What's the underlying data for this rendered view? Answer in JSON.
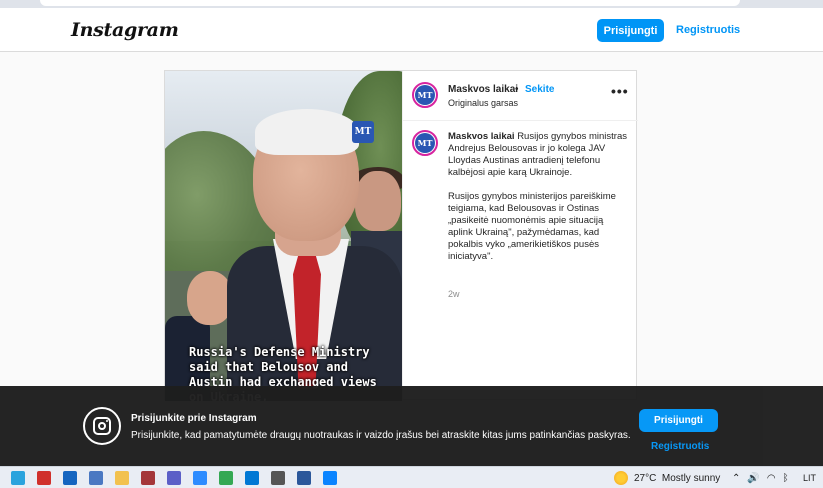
{
  "header": {
    "logo": "Instagram",
    "login_label": "Prisijungti",
    "register_label": "Registruotis"
  },
  "post": {
    "account": "Maskvos laikai",
    "separator": "•",
    "follow_label": "Sekite",
    "audio": "Originalus garsas",
    "more_label": "•••",
    "avatar_text": "MT",
    "watermark": "MT",
    "subtitle": "Russia's Defense Ministry said that Belousov and Austin had exchanged views on Ukraine,",
    "caption_p1": "Rusijos gynybos ministras Andrejus Belousovas ir jo kolega JAV Lloydas Austinas antradienį telefonu kalbėjosi apie karą Ukrainoje.",
    "caption_p2": "Rusijos gynybos ministerijos pareiškime teigiama, kad Belousovas ir Ostinas „pasikeitė nuomonėmis apie situaciją aplink Ukrainą\", pažymėdamas, kad pokalbis vyko „amerikietiškos pusės iniciatyva\".",
    "time_ago": "2w"
  },
  "overlay": {
    "title": "Prisijunkite prie Instagram",
    "text": "Prisijunkite, kad pamatytumėte draugų nuotraukas ir vaizdo įrašus bei atraskite kitas jums patinkančias paskyras.",
    "login_label": "Prisijungti",
    "register_label": "Registruotis",
    "icon": "instagram-icon"
  },
  "taskbar": {
    "apps": [
      {
        "icon": "telegram-icon",
        "color": "#2aa3dd"
      },
      {
        "icon": "acrobat-icon",
        "color": "#d0302b"
      },
      {
        "icon": "outlook-icon",
        "color": "#1565c0"
      },
      {
        "icon": "notepad-icon",
        "color": "#4a78c2"
      },
      {
        "icon": "folder-icon",
        "color": "#f2c14e"
      },
      {
        "icon": "access-icon",
        "color": "#a4373a"
      },
      {
        "icon": "teams-icon",
        "color": "#5b5fc7"
      },
      {
        "icon": "zoom-icon",
        "color": "#2d8cff"
      },
      {
        "icon": "chrome-icon",
        "color": "#34a853"
      },
      {
        "icon": "store-icon",
        "color": "#0078d4"
      },
      {
        "icon": "game-icon",
        "color": "#555555"
      },
      {
        "icon": "word-icon",
        "color": "#2b579a"
      },
      {
        "icon": "photos-icon",
        "color": "#0a84ff"
      }
    ],
    "temperature": "27°C",
    "weather": "Mostly sunny",
    "language": "LIT"
  }
}
